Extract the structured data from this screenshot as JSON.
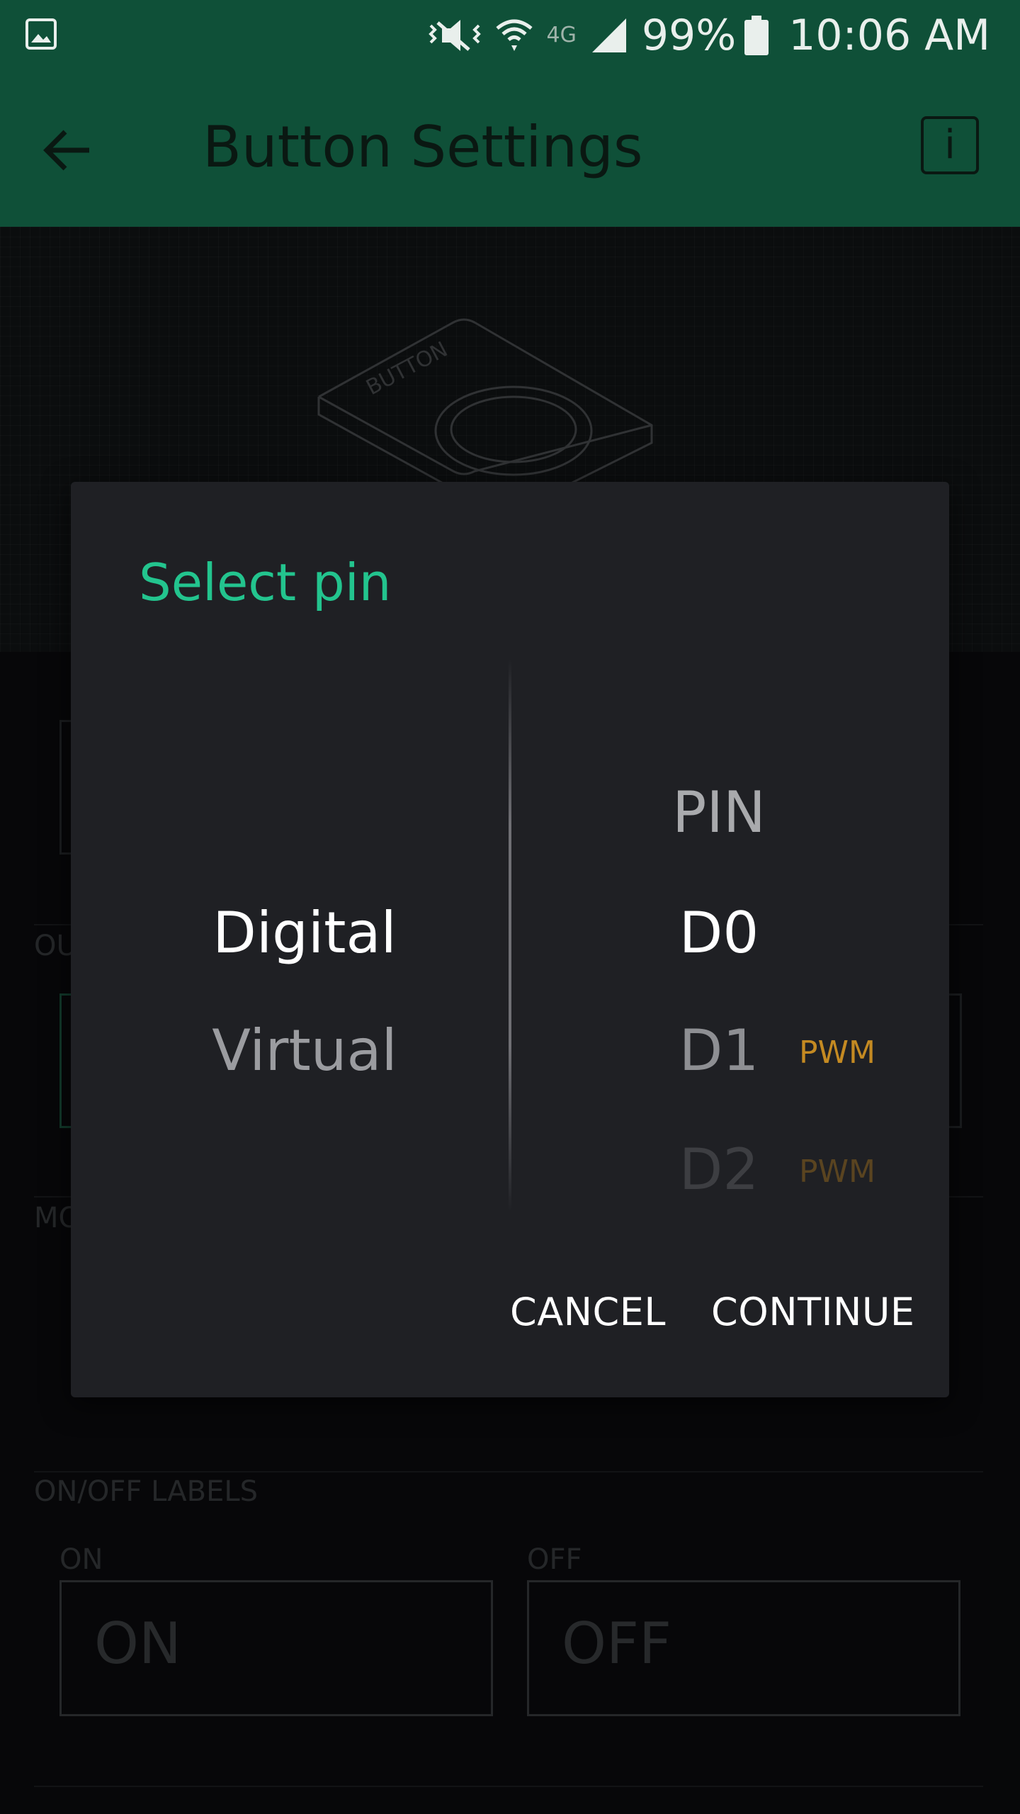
{
  "status_bar": {
    "battery": "99%",
    "time": "10:06 AM",
    "network_label": "4G",
    "icons": [
      "gallery-icon",
      "vibrate-icon",
      "wifi-icon",
      "lte-icon",
      "signal-icon",
      "battery-icon"
    ]
  },
  "app_bar": {
    "title": "Button Settings",
    "info_label": "i",
    "icons": [
      "back-arrow-icon",
      "info-icon"
    ]
  },
  "widget_preview": {
    "illustration_text": "BUTTON"
  },
  "background_form": {
    "output_label": "OU",
    "mode_label": "MO",
    "labels_section": "ON/OFF LABELS",
    "on_label": "ON",
    "off_label": "OFF",
    "on_value": "ON",
    "off_value": "OFF"
  },
  "dialog": {
    "title": "Select pin",
    "pin_types": [
      "Digital",
      "Virtual"
    ],
    "selected_type": "Digital",
    "pin_header": "PIN",
    "pins": [
      {
        "name": "D0",
        "tag": ""
      },
      {
        "name": "D1",
        "tag": "PWM"
      },
      {
        "name": "D2",
        "tag": "PWM"
      }
    ],
    "selected_pin": "D0",
    "cancel_label": "CANCEL",
    "continue_label": "CONTINUE",
    "accent_color": "#23c48e",
    "pwm_color": "#c48a22"
  }
}
